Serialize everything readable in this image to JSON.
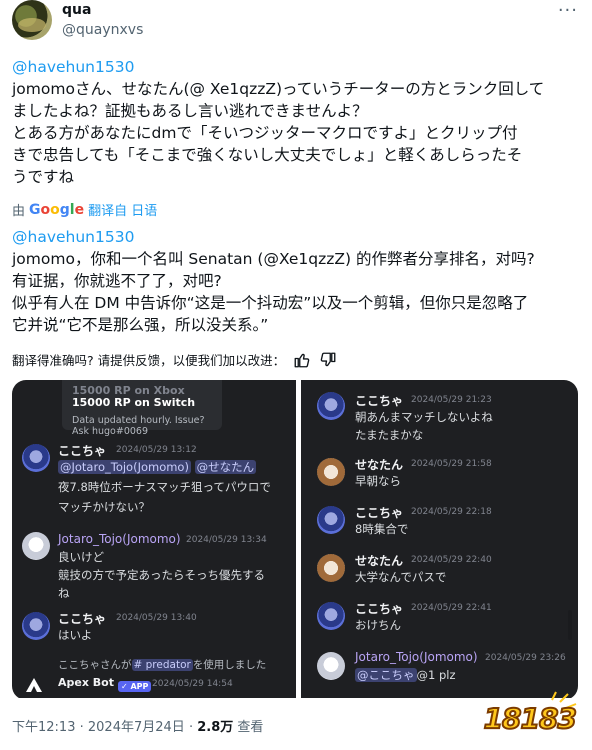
{
  "tweet": {
    "display_name": "qua",
    "handle": "@quaynxvs",
    "more_icon": "more-dots",
    "original": {
      "mention": "@havehun1530",
      "lines": [
        "jomomoさん、せなたん(@ Xe1qzzZ)っていうチーターの方とランク回して",
        "ましたよね？証拠もあるし言い逃れできませんよ？",
        "とある方があなたにdmで「そいつジッターマクロですよ」とクリップ付",
        "きで忠告しても「そこまで強くないし大丈夫でしょ」と軽くあしらったそ",
        "うですね"
      ]
    },
    "translation_bar": {
      "prefix": "由",
      "engine": "Google",
      "link": "翻译自 日语"
    },
    "translated": {
      "mention": "@havehun1530",
      "lines": [
        "jomomo，你和一个名叫 Senatan (@Xe1qzzZ) 的作弊者分享排名，对吗?",
        "有证据，你就逃不了了，对吧?",
        "似乎有人在 DM 中告诉你“这是一个抖动宏”以及一个剪辑，但你只是忽略了",
        "它并说“它不是那么强，所以没关系。”"
      ]
    },
    "feedback": {
      "text": "翻译得准确吗? 请提供反馈，以便我们加以改进：",
      "up_icon": "thumbs-up-icon",
      "down_icon": "thumbs-down-icon"
    },
    "meta": {
      "time": "下午12:13",
      "date": "2024年7月24日",
      "sep": "·",
      "views": "2.8万",
      "views_label": "查看"
    },
    "watermark": "18183"
  },
  "screenshot_left": {
    "stats_faded": "15000 RP on Xbox",
    "stats_rp": "15000 RP on Switch",
    "stats_note": "Data updated hourly. Issue? Ask hugo#0069",
    "messages": [
      {
        "user": "ここちゃ",
        "time": "2024/05/29 13:12",
        "mention": "@Jotaro_Tojo(Jomomo)",
        "mention2": "@せなたん",
        "lines": [
          "夜7.8時位ボーナスマッチ狙ってパウロで",
          "マッチかけない？"
        ]
      },
      {
        "user": "Jotaro_Tojo(Jomomo)",
        "time": "2024/05/29 13:34",
        "lines": [
          "良いけど",
          "競技の方で予定あったらそっち優先する",
          "ね"
        ]
      },
      {
        "user": "ここちゃ",
        "time": "2024/05/29 13:40",
        "lines": [
          "はいよ"
        ]
      },
      {
        "system": "ここちゃさんが",
        "role": "predator",
        "system_end": "を使用しました",
        "bot": "Apex Bot",
        "bot_badge": "✓ APP",
        "bot_time": "2024/05/29 14:54"
      }
    ]
  },
  "screenshot_right": {
    "messages": [
      {
        "user": "ここちゃ",
        "time": "2024/05/29 21:23",
        "lines": [
          "朝あんまマッチしないよね",
          "たまたまかな"
        ]
      },
      {
        "user": "せなたん",
        "time": "2024/05/29 21:58",
        "lines": [
          "早朝なら"
        ]
      },
      {
        "user": "ここちゃ",
        "time": "2024/05/29 22:18",
        "lines": [
          "8時集合で"
        ]
      },
      {
        "user": "せなたん",
        "time": "2024/05/29 22:40",
        "lines": [
          "大学なんでパスで"
        ]
      },
      {
        "user": "ここちゃ",
        "time": "2024/05/29 22:41",
        "lines": [
          "おけちん"
        ]
      },
      {
        "user": "Jotaro_Tojo(Jomomo)",
        "time": "2024/05/29 23:26",
        "mention": "@ここちゃ",
        "tail": "@1 plz"
      }
    ]
  }
}
